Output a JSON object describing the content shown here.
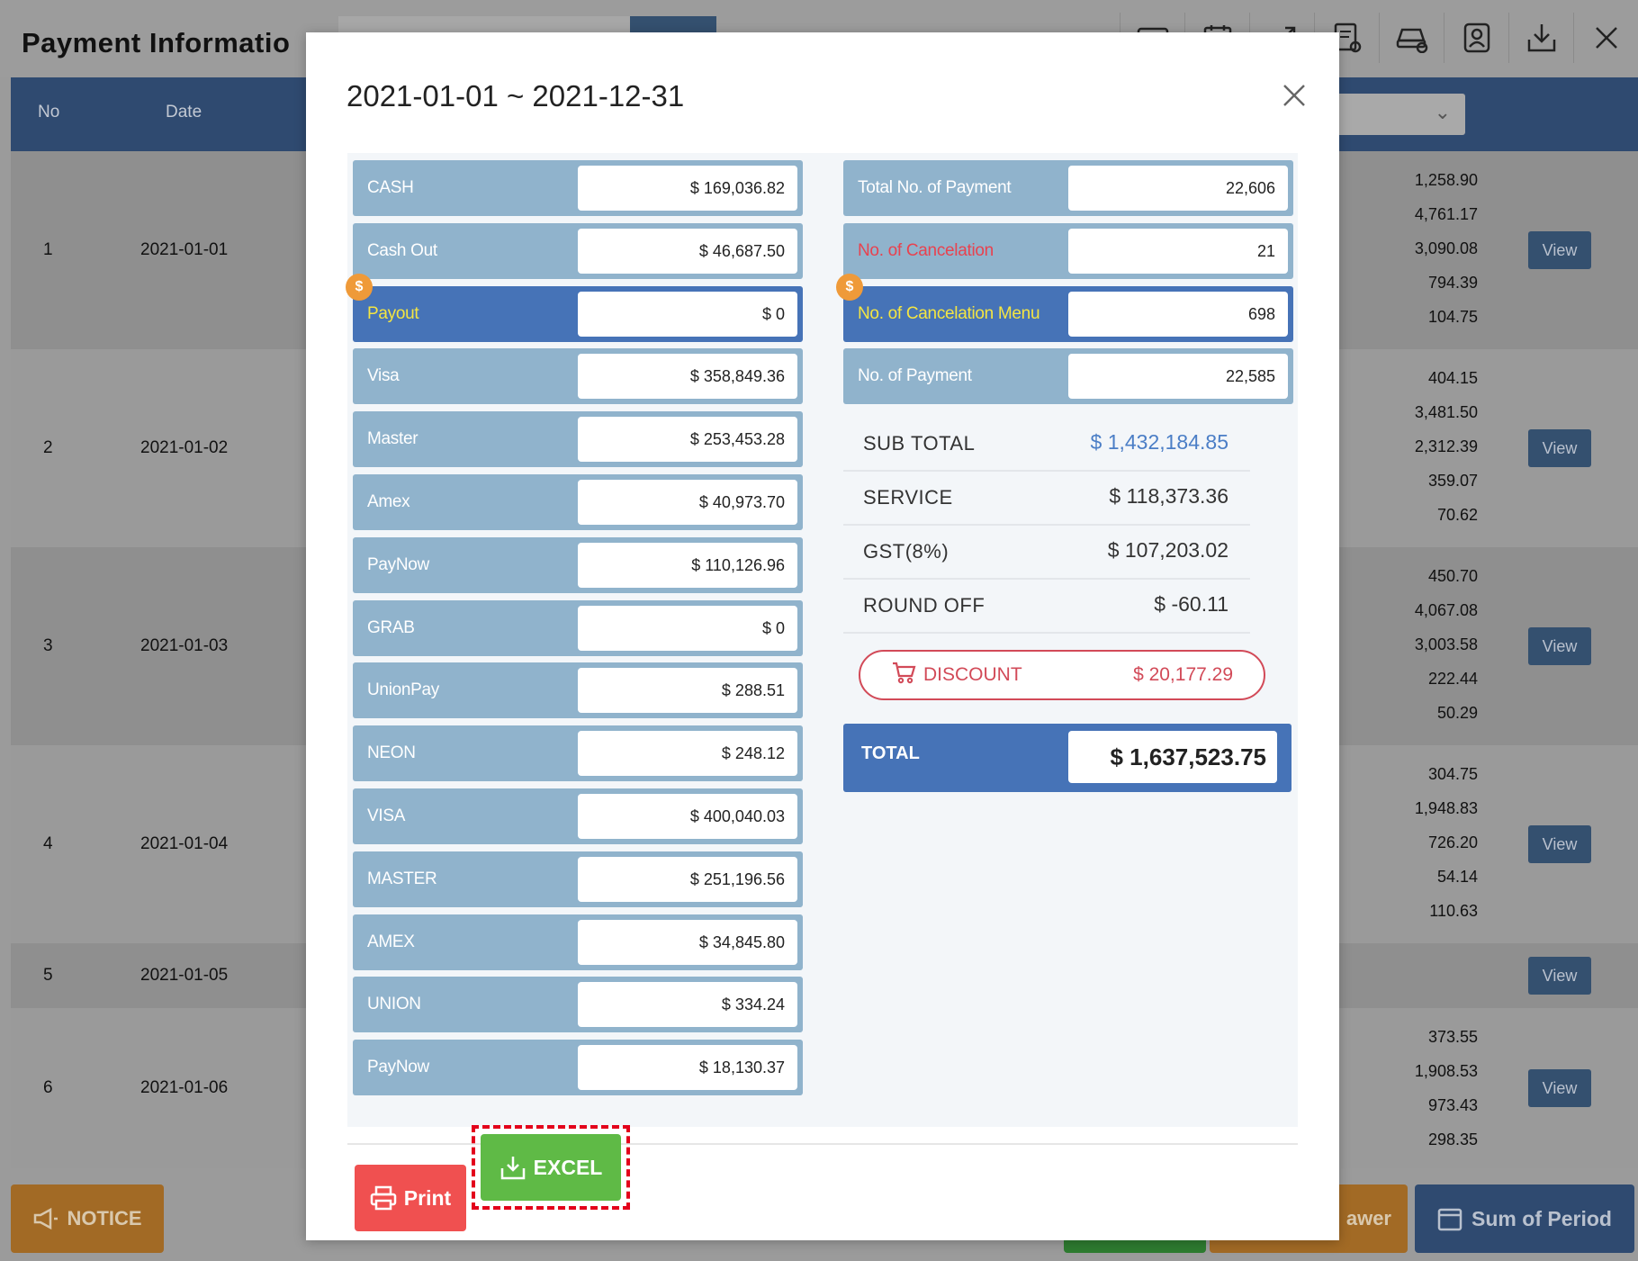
{
  "page": {
    "title": "Payment Informatio",
    "header_icons": [
      "card-icon",
      "calendar-icon",
      "expand-icon",
      "receipt-settings-icon",
      "car-settings-icon",
      "user-badge-icon",
      "download-icon",
      "close-icon"
    ],
    "table_headers": {
      "no": "No",
      "date": "Date"
    },
    "rows": [
      {
        "no": "1",
        "date": "2021-01-01",
        "values": [
          "1,258.90",
          "4,761.17",
          "3,090.08",
          "794.39",
          "104.75"
        ],
        "view": "View"
      },
      {
        "no": "2",
        "date": "2021-01-02",
        "values": [
          "404.15",
          "3,481.50",
          "2,312.39",
          "359.07",
          "70.62"
        ],
        "view": "View"
      },
      {
        "no": "3",
        "date": "2021-01-03",
        "values": [
          "450.70",
          "4,067.08",
          "3,003.58",
          "222.44",
          "50.29"
        ],
        "view": "View"
      },
      {
        "no": "4",
        "date": "2021-01-04",
        "values": [
          "304.75",
          "1,948.83",
          "726.20",
          "54.14",
          "110.63"
        ],
        "view": "View"
      },
      {
        "no": "5",
        "date": "2021-01-05",
        "values": [],
        "view": "View"
      },
      {
        "no": "6",
        "date": "2021-01-06",
        "values": [
          "373.55",
          "1,908.53",
          "973.43",
          "298.35"
        ],
        "view": "View"
      }
    ],
    "footer": {
      "notice": "NOTICE",
      "drawer": "awer",
      "sum_of_period": "Sum of Period"
    }
  },
  "modal": {
    "title": "2021-01-01 ~ 2021-12-31",
    "payments": [
      {
        "label": "CASH",
        "value": "$ 169,036.82"
      },
      {
        "label": "Cash Out",
        "value": "$ 46,687.50"
      },
      {
        "label": "Payout",
        "value": "$ 0",
        "highlight": true,
        "coin": "$"
      },
      {
        "label": "Visa",
        "value": "$ 358,849.36"
      },
      {
        "label": "Master",
        "value": "$ 253,453.28"
      },
      {
        "label": "Amex",
        "value": "$ 40,973.70"
      },
      {
        "label": "PayNow",
        "value": "$ 110,126.96"
      },
      {
        "label": "GRAB",
        "value": "$ 0"
      },
      {
        "label": "UnionPay",
        "value": "$ 288.51"
      },
      {
        "label": "NEON",
        "value": "$ 248.12"
      },
      {
        "label": "VISA",
        "value": "$ 400,040.03"
      },
      {
        "label": "MASTER",
        "value": "$ 251,196.56"
      },
      {
        "label": "AMEX",
        "value": "$ 34,845.80"
      },
      {
        "label": "UNION",
        "value": "$ 334.24"
      },
      {
        "label": "PayNow",
        "value": "$ 18,130.37"
      }
    ],
    "counts": [
      {
        "label": "Total No. of Payment",
        "value": "22,606"
      },
      {
        "label": "No. of Cancelation",
        "value": "21",
        "red": true
      },
      {
        "label": "No. of Cancelation Menu",
        "value": "698",
        "highlight": true,
        "coin": "$"
      },
      {
        "label": "No. of Payment",
        "value": "22,585"
      }
    ],
    "summary": [
      {
        "label": "SUB TOTAL",
        "value": "$ 1,432,184.85",
        "blue": true
      },
      {
        "label": "SERVICE",
        "value": "$ 118,373.36"
      },
      {
        "label": "GST(8%)",
        "value": "$ 107,203.02"
      },
      {
        "label": "ROUND OFF",
        "value": "$ -60.11"
      }
    ],
    "discount": {
      "label": "DISCOUNT",
      "value": "$ 20,177.29"
    },
    "total": {
      "label": "TOTAL",
      "value": "$ 1,637,523.75"
    },
    "buttons": {
      "print": "Print",
      "excel": "EXCEL"
    }
  },
  "colors": {
    "primary_blue": "#4673b7",
    "light_blue": "#90b3cc",
    "danger_red": "#f05050",
    "excel_green": "#5fba46",
    "highlight_frame": "#e3001b"
  }
}
